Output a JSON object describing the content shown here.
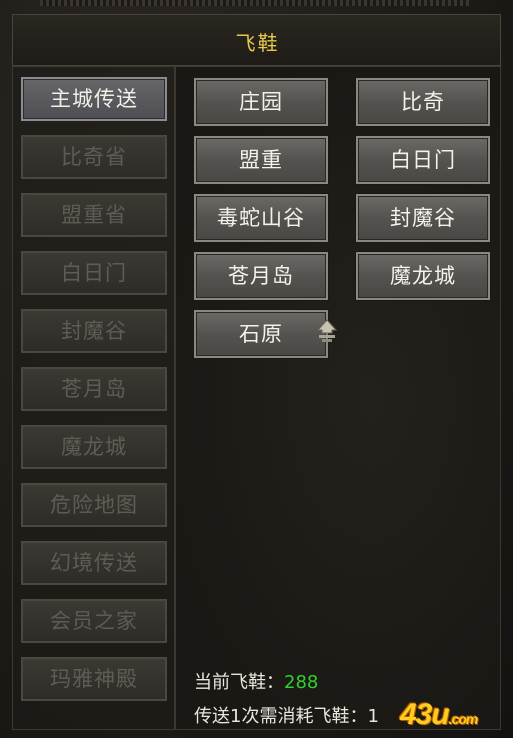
{
  "window": {
    "title": "飞鞋"
  },
  "left_menu": [
    {
      "label": "主城传送",
      "active": true
    },
    {
      "label": "比奇省",
      "active": false
    },
    {
      "label": "盟重省",
      "active": false
    },
    {
      "label": "白日门",
      "active": false
    },
    {
      "label": "封魔谷",
      "active": false
    },
    {
      "label": "苍月岛",
      "active": false
    },
    {
      "label": "魔龙城",
      "active": false
    },
    {
      "label": "危险地图",
      "active": false
    },
    {
      "label": "幻境传送",
      "active": false
    },
    {
      "label": "会员之家",
      "active": false
    },
    {
      "label": "玛雅神殿",
      "active": false
    }
  ],
  "destinations": [
    {
      "label": "庄园"
    },
    {
      "label": "比奇"
    },
    {
      "label": "盟重"
    },
    {
      "label": "白日门"
    },
    {
      "label": "毒蛇山谷"
    },
    {
      "label": "封魔谷"
    },
    {
      "label": "苍月岛"
    },
    {
      "label": "魔龙城"
    },
    {
      "label": "石原"
    }
  ],
  "info": {
    "shoes_label": "当前飞鞋：",
    "shoes_count": "288",
    "cost_label": "传送1次需消耗飞鞋：1"
  },
  "watermark": {
    "text": "43u",
    "suffix": ".com"
  },
  "colors": {
    "title": "#e7c84a",
    "count": "#2fd12f"
  }
}
